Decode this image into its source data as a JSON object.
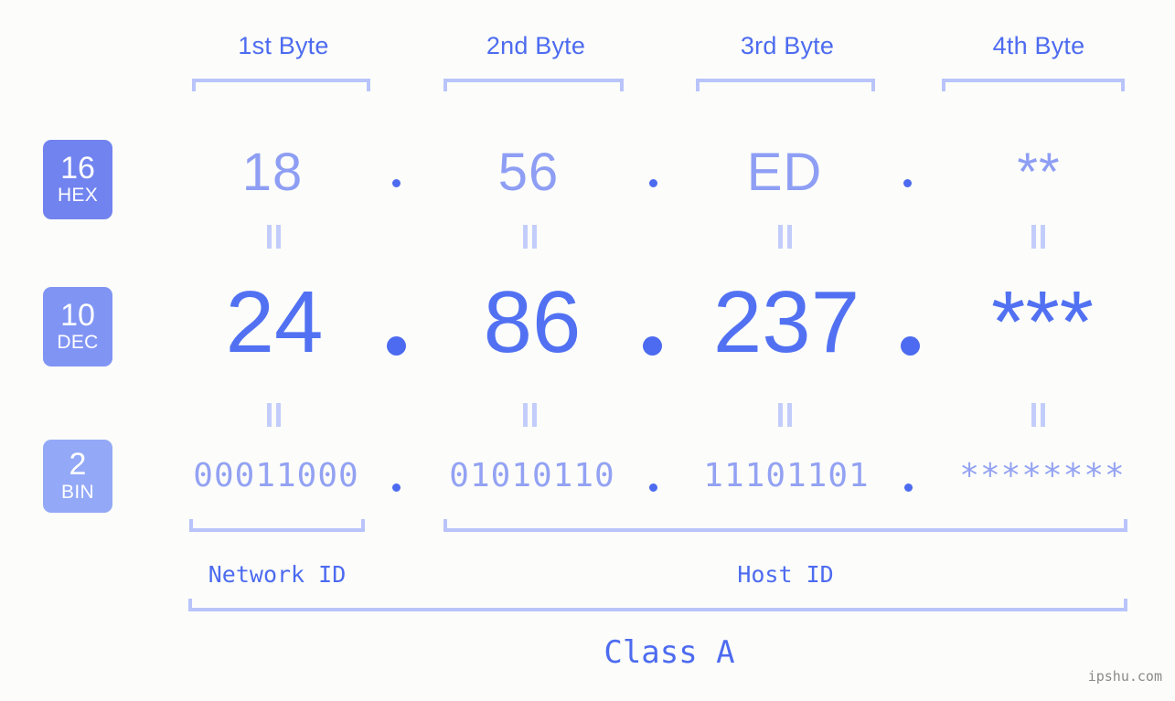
{
  "page": {
    "background_color": "#fcfdfa",
    "watermark": "ipshu.com"
  },
  "colors": {
    "accent": "#4d6bf0",
    "dec_value": "#5271f2",
    "hex_value": "#8e9ef4",
    "bin_value": "#93a2f3",
    "bracket": "#b9c4fb",
    "equals_mark": "#c3cdfc",
    "badge_hex": "#7183ef",
    "badge_dec": "#8094f4",
    "badge_bin": "#93a9f7"
  },
  "byte_headers": [
    {
      "label": "1st Byte"
    },
    {
      "label": "2nd Byte"
    },
    {
      "label": "3rd Byte"
    },
    {
      "label": "4th Byte"
    }
  ],
  "rows": [
    {
      "id": "hex",
      "badge": {
        "number": "16",
        "name": "HEX"
      },
      "values": [
        "18",
        "56",
        "ED",
        "**"
      ],
      "separators": [
        ".",
        ".",
        "."
      ]
    },
    {
      "id": "dec",
      "badge": {
        "number": "10",
        "name": "DEC"
      },
      "values": [
        "24",
        "86",
        "237",
        "***"
      ],
      "separators": [
        ".",
        ".",
        "."
      ]
    },
    {
      "id": "bin",
      "badge": {
        "number": "2",
        "name": "BIN"
      },
      "values": [
        "00011000",
        "01010110",
        "11101101",
        "********"
      ],
      "separators": [
        ".",
        ".",
        "."
      ]
    }
  ],
  "sections": [
    {
      "label": "Network ID"
    },
    {
      "label": "Host ID"
    }
  ],
  "class": {
    "label": "Class A"
  }
}
